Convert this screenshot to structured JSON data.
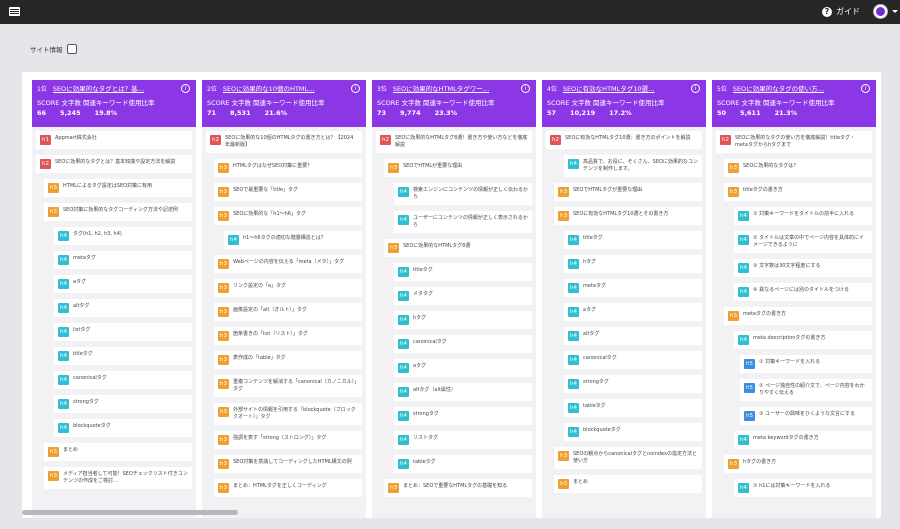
{
  "topbar": {
    "guide_label": "ガイド"
  },
  "controls": {
    "site_info_label": "サイト情報"
  },
  "columns": [
    {
      "rank": "1位",
      "title": "SEOに効果的なタグとは？基…",
      "labels": "SCORE 文字数 関連キーワード使用比率",
      "score": "66",
      "chars": "5,245",
      "ratio": "19.8%",
      "items": [
        {
          "level": "h1",
          "text": "Appmart株式会社"
        },
        {
          "level": "h2",
          "text": "SEOに効果的なタグとは？基本知識や設定方法を解説"
        },
        {
          "level": "h3",
          "text": "HTMLによるタグ設定はSEO対策に有用"
        },
        {
          "level": "h3",
          "text": "SEO対策に効果的なタグコーディング方法や記述例"
        },
        {
          "level": "h4",
          "text": "タグ(h1, h2, h3, h4)"
        },
        {
          "level": "h4",
          "text": "metaタグ"
        },
        {
          "level": "h4",
          "text": "aタグ"
        },
        {
          "level": "h4",
          "text": "altタグ"
        },
        {
          "level": "h4",
          "text": "listタグ"
        },
        {
          "level": "h4",
          "text": "titleタグ"
        },
        {
          "level": "h4",
          "text": "canonicalタグ"
        },
        {
          "level": "h4",
          "text": "strongタグ"
        },
        {
          "level": "h4",
          "text": "blockquoteタグ"
        },
        {
          "level": "h3",
          "text": "まとめ"
        },
        {
          "level": "h3",
          "text": "メディア担当者して可能！SEOチェックリスト付きコンテンツの作成をご検討…"
        }
      ]
    },
    {
      "rank": "2位",
      "title": "SEOに効果的な10個のHTML…",
      "labels": "SCORE 文字数 関連キーワード使用比率",
      "score": "71",
      "chars": "8,531",
      "ratio": "21.6%",
      "items": [
        {
          "level": "h2",
          "text": "SEOに効果的な10個のHTMLタグの書き方とは？【2024年最新版】"
        },
        {
          "level": "h3",
          "text": "HTMLタグはなぜSEO対策に重要？"
        },
        {
          "level": "h3",
          "text": "SEOで最重要な「title」タグ"
        },
        {
          "level": "h3",
          "text": "SEOに効果的な「h1〜h6」タグ"
        },
        {
          "level": "h4",
          "text": "h1〜h6タグの適切な階層構造とは？"
        },
        {
          "level": "h3",
          "text": "Webページの内容を伝える「meta（メタ）」タグ"
        },
        {
          "level": "h3",
          "text": "リンク設定の「a」タグ"
        },
        {
          "level": "h3",
          "text": "画像設定の「alt（オルト）」タグ"
        },
        {
          "level": "h3",
          "text": "箇条書きの「list（リスト）」タグ"
        },
        {
          "level": "h3",
          "text": "表作成の「table」タグ"
        },
        {
          "level": "h3",
          "text": "重複コンテンツを解消する「canonical（カノニカル）」タグ"
        },
        {
          "level": "h3",
          "text": "外部サイトの情報を引用する「blockquote（ブロッククオート）」タグ"
        },
        {
          "level": "h3",
          "text": "強調を表す「strong（ストロング）」タグ"
        },
        {
          "level": "h3",
          "text": "SEO対策を意識してコーディングしたHTML構文の例"
        },
        {
          "level": "h3",
          "text": "まとめ：HTMLタグを正しくコーディング"
        }
      ]
    },
    {
      "rank": "3位",
      "title": "SEOに効果的なHTMLタグワー…",
      "labels": "SCORE 文字数 関連キーワード使用比率",
      "score": "73",
      "chars": "9,774",
      "ratio": "23.3%",
      "items": [
        {
          "level": "h2",
          "text": "SEOに効果的なHTMLタグ8選！書き方や使い方などを徹底解説"
        },
        {
          "level": "h3",
          "text": "SEOでHTMLが重要な理由"
        },
        {
          "level": "h4",
          "text": "検索エンジンにコンテンツの情報が正しく伝わるから"
        },
        {
          "level": "h4",
          "text": "ユーザーにコンテンツの情報が正しく表示されるから"
        },
        {
          "level": "h3",
          "text": "SEOに効果的なHTMLタグ8選"
        },
        {
          "level": "h4",
          "text": "titleタグ"
        },
        {
          "level": "h4",
          "text": "メタタグ"
        },
        {
          "level": "h4",
          "text": "hタグ"
        },
        {
          "level": "h4",
          "text": "canonicalタグ"
        },
        {
          "level": "h4",
          "text": "aタグ"
        },
        {
          "level": "h4",
          "text": "altタグ（alt属性）"
        },
        {
          "level": "h4",
          "text": "strongタグ"
        },
        {
          "level": "h4",
          "text": "リストタグ"
        },
        {
          "level": "h4",
          "text": "tableタグ"
        },
        {
          "level": "h3",
          "text": "まとめ：SEOで重要なHTMLタグの基礎を知る"
        }
      ]
    },
    {
      "rank": "4位",
      "title": "SEOに有効なHTMLタグ10選…",
      "labels": "SCORE 文字数 関連キーワード使用比率",
      "score": "57",
      "chars": "10,219",
      "ratio": "17.2%",
      "items": [
        {
          "level": "h2",
          "text": "SEOに有効なHTMLタグ10選：書き方のポイントを解説"
        },
        {
          "level": "h4",
          "text": "高品質で、お役に、そくさん、SEOに効果的なコンテンツを制作します。"
        },
        {
          "level": "h3",
          "text": "SEOでHTMLタグが重要な理由"
        },
        {
          "level": "h3",
          "text": "SEOに有効なHTMLタグ10選とその書き方"
        },
        {
          "level": "h4",
          "text": "titleタグ"
        },
        {
          "level": "h4",
          "text": "hタグ"
        },
        {
          "level": "h4",
          "text": "metaタグ"
        },
        {
          "level": "h4",
          "text": "aタグ"
        },
        {
          "level": "h4",
          "text": "altタグ"
        },
        {
          "level": "h4",
          "text": "canonicalタグ"
        },
        {
          "level": "h4",
          "text": "strongタグ"
        },
        {
          "level": "h4",
          "text": "tableタグ"
        },
        {
          "level": "h4",
          "text": "blockquoteタグ"
        },
        {
          "level": "h3",
          "text": "SEOの観点からcanonicalタグとnoindexの指定方法と使い方"
        },
        {
          "level": "h3",
          "text": "まとめ"
        }
      ]
    },
    {
      "rank": "5位",
      "title": "SEOに効果的なタグの使い方…",
      "labels": "SCORE 文字数 関連キーワード使用比率",
      "score": "50",
      "chars": "5,611",
      "ratio": "21.3%",
      "items": [
        {
          "level": "h2",
          "text": "SEOに効果的なタグの使い方を徹底解説！titleタグ・metaタグからhタグまで"
        },
        {
          "level": "h3",
          "text": "SEOに効果的なタグは？"
        },
        {
          "level": "h3",
          "text": "titleタグの書き方"
        },
        {
          "level": "h4",
          "text": "① 対策キーワードをタイトルの前半に入れる"
        },
        {
          "level": "h4",
          "text": "② タイトルは文章の中でページ内容を具体的にイメージできるように"
        },
        {
          "level": "h4",
          "text": "③ 文字数は30文字程度にする"
        },
        {
          "level": "h4",
          "text": "④ 異なるページには別のタイトルをつける"
        },
        {
          "level": "h3",
          "text": "metaタグの書き方"
        },
        {
          "level": "h4",
          "text": "meta descriptionタグの書き方"
        },
        {
          "level": "h5",
          "text": "① 対策キーワードを入れる"
        },
        {
          "level": "h5",
          "text": "② ページ独自性の紹介文で、ページ内容をわかりやすく伝える"
        },
        {
          "level": "h5",
          "text": "③ ユーザーの興味をひくような文言にする"
        },
        {
          "level": "h4",
          "text": "meta keywordタグの書き方"
        },
        {
          "level": "h3",
          "text": "hタグの書き方"
        },
        {
          "level": "h4",
          "text": "① h1には対策キーワードを入れる"
        }
      ]
    }
  ]
}
